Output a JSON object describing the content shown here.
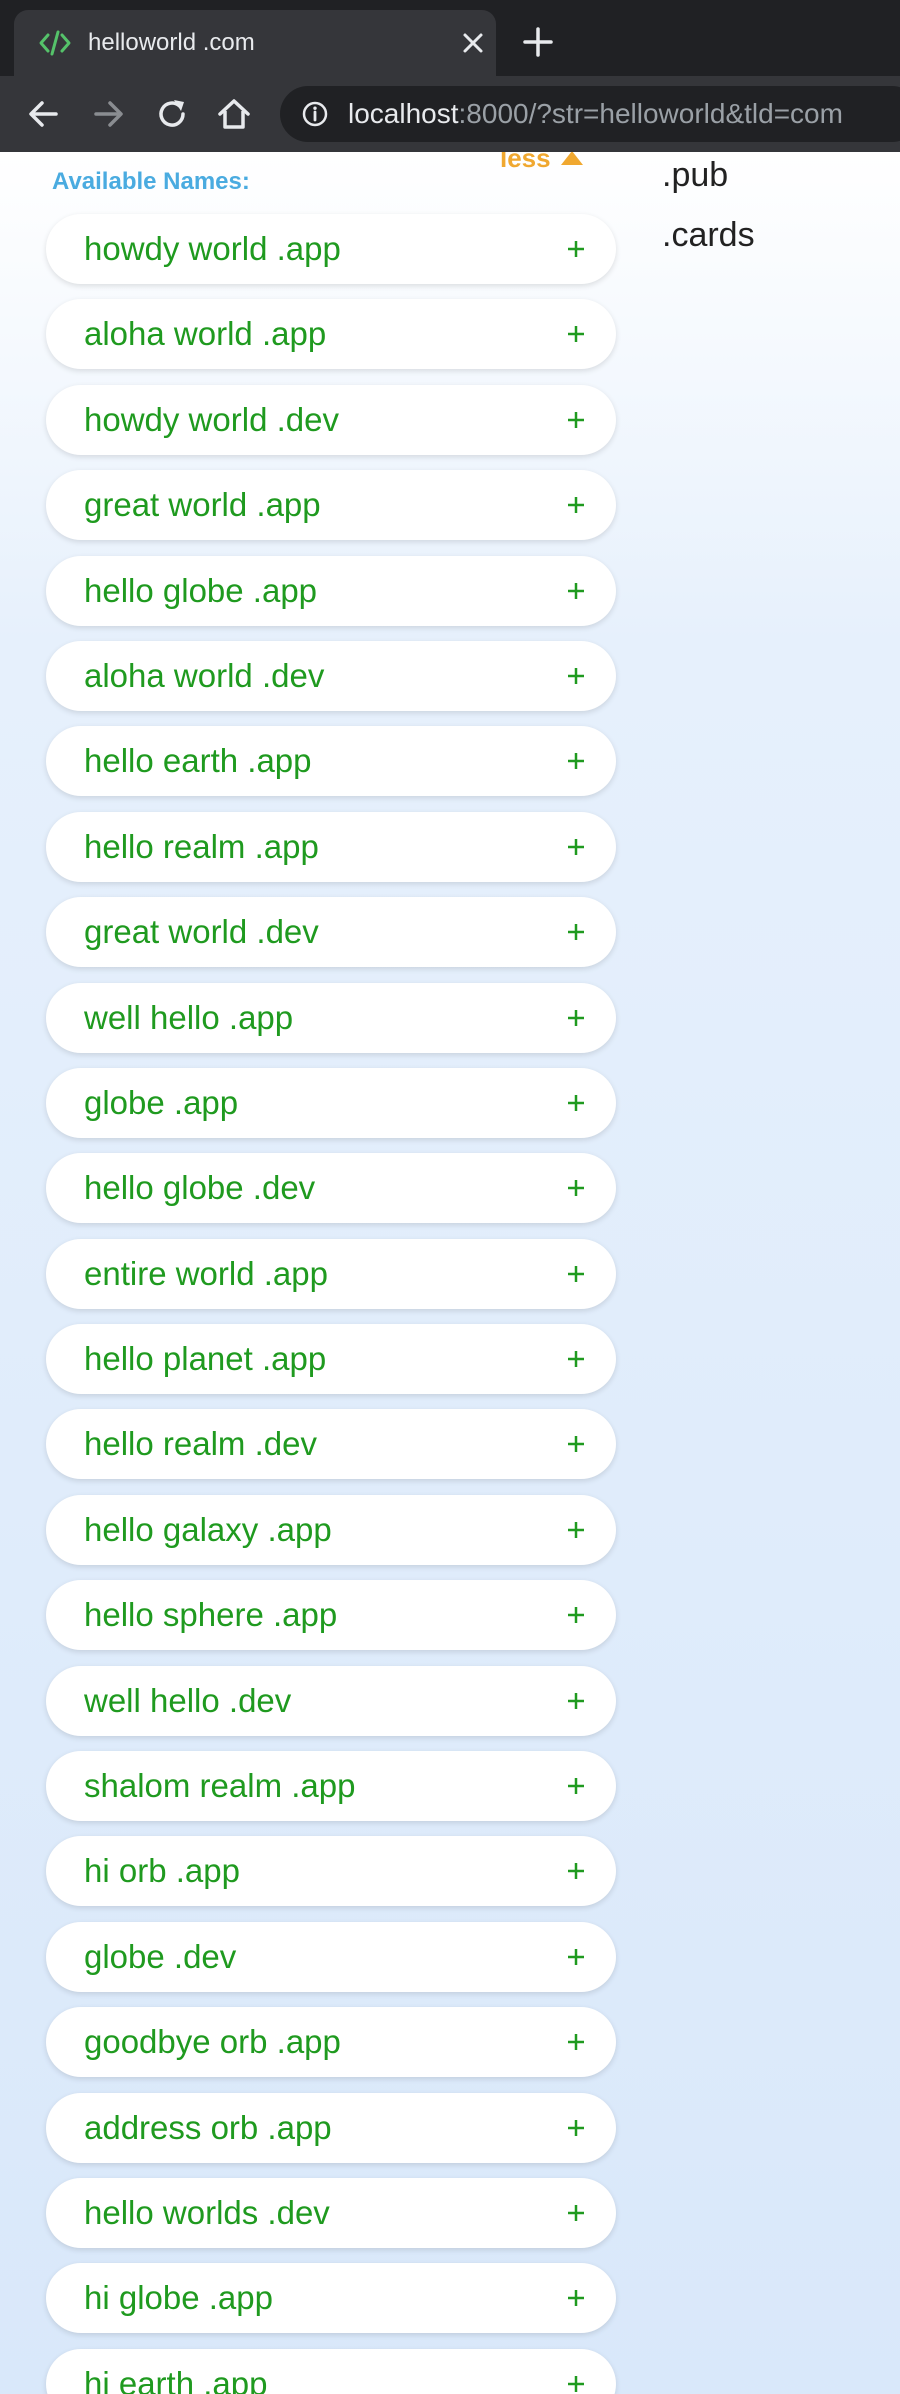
{
  "browser": {
    "tab_title": "helloworld .com",
    "url_host": "localhost",
    "url_rest": ":8000/?str=helloworld&tld=com"
  },
  "sidebar": {
    "available_label": "Available Names:",
    "less_label": "less"
  },
  "tlds": [
    ".pub",
    ".cards"
  ],
  "names": [
    "howdy world .app",
    "aloha world .app",
    "howdy world .dev",
    "great world .app",
    "hello globe .app",
    "aloha world .dev",
    "hello earth .app",
    "hello realm .app",
    "great world .dev",
    "well hello .app",
    "globe .app",
    "hello globe .dev",
    "entire world .app",
    "hello planet .app",
    "hello realm .dev",
    "hello galaxy .app",
    "hello sphere .app",
    "well hello .dev",
    "shalom realm .app",
    "hi orb .app",
    "globe .dev",
    "goodbye orb .app",
    "address orb .app",
    "hello worlds .dev",
    "hi globe .app",
    "hi earth .app"
  ],
  "colors": {
    "name_green": "#1f9a1f",
    "label_blue": "#4aabe0",
    "less_orange": "#f0a830"
  }
}
